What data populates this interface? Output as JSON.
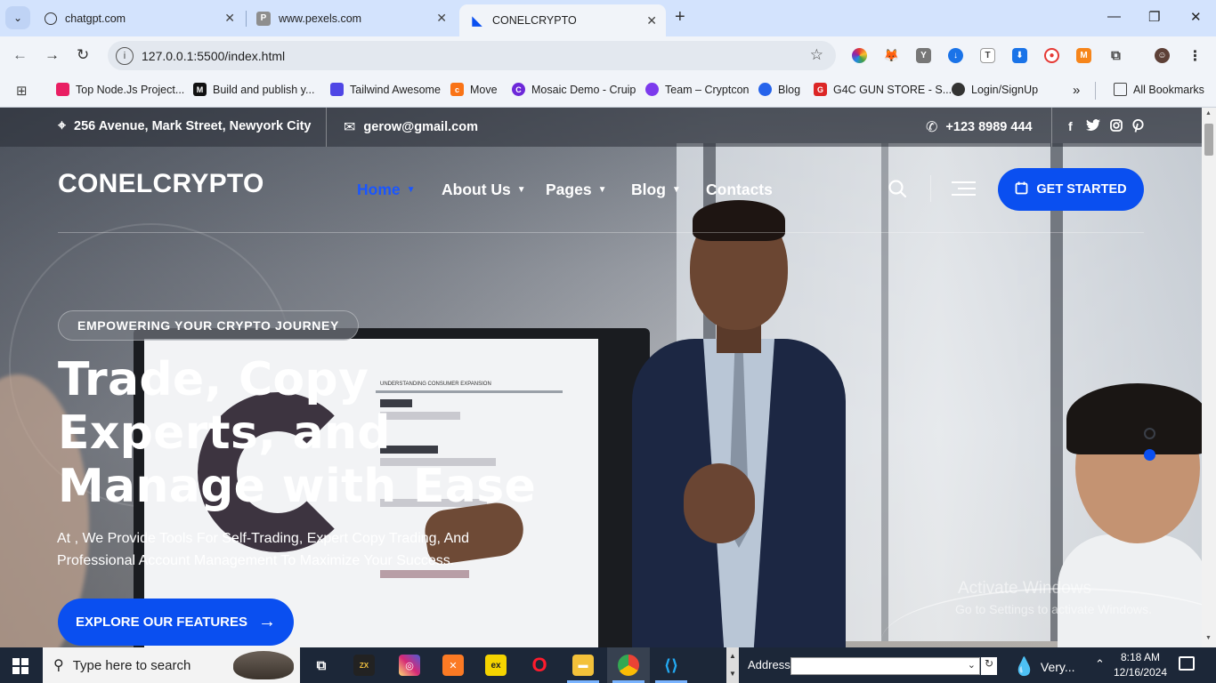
{
  "browser": {
    "tabs": [
      {
        "title": "chatgpt.com",
        "favicon": "chatgpt-icon"
      },
      {
        "title": "www.pexels.com",
        "favicon": "pexels-icon"
      },
      {
        "title": "CONELCRYPTO",
        "favicon": "conelcrypto-icon",
        "active": true
      }
    ],
    "url": "127.0.0.1:5500/index.html",
    "bookmarks": [
      {
        "label": "Top Node.Js Project...",
        "color": "#e91e63"
      },
      {
        "label": "Build and publish y...",
        "color": "#111111"
      },
      {
        "label": "Tailwind Awesome",
        "color": "#4f46e5"
      },
      {
        "label": "Move",
        "color": "#f97316"
      },
      {
        "label": "Mosaic Demo - Cruip",
        "color": "#6d28d9"
      },
      {
        "label": "Team – Cryptcon",
        "color": "#7c3aed"
      },
      {
        "label": "Blog",
        "color": "#2563eb"
      },
      {
        "label": "G4C GUN STORE - S...",
        "color": "#dc2626"
      },
      {
        "label": "Login/SignUp",
        "color": "#333333"
      }
    ],
    "all_bookmarks": "All Bookmarks",
    "more_bookmarks": "»"
  },
  "site": {
    "topbar": {
      "address": "256 Avenue, Mark Street, Newyork City",
      "email": "gerow@gmail.com",
      "phone": "+123 8989 444",
      "social": [
        "f",
        "twitter-icon",
        "instagram-icon",
        "pinterest-icon"
      ]
    },
    "logo": "CONELCRYPTO",
    "nav": [
      {
        "label": "Home",
        "has_dropdown": true,
        "active": true
      },
      {
        "label": "About Us",
        "has_dropdown": true
      },
      {
        "label": "Pages",
        "has_dropdown": true
      },
      {
        "label": "Blog",
        "has_dropdown": true
      },
      {
        "label": "Contacts",
        "has_dropdown": false
      }
    ],
    "cta_header": "GET STARTED",
    "hero": {
      "badge": "EMPOWERING YOUR CRYPTO JOURNEY",
      "headline_lines": [
        "Trade, Copy",
        "Experts, and",
        "Manage with Ease"
      ],
      "subtitle": "At , We Provide Tools For Self-Trading, Expert Copy Trading, And Professional Account Management To Maximize Your Success.",
      "cta": "EXPLORE OUR FEATURES",
      "slide_count": 2,
      "active_slide": 2
    },
    "accent_color": "#0a4ff0",
    "watermark": [
      "Activate Windows",
      "Go to Settings to activate Windows."
    ]
  },
  "taskbar": {
    "search_placeholder": "Type here to search",
    "address_label": "Address",
    "weather": "Very...",
    "time": "8:18 AM",
    "date": "12/16/2024"
  }
}
